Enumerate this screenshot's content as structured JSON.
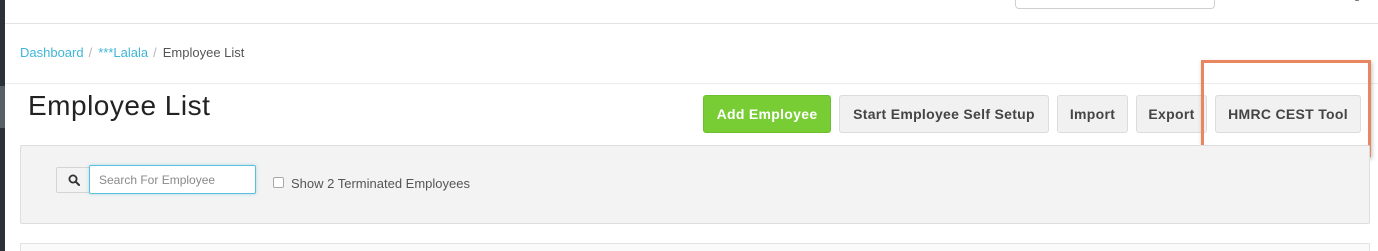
{
  "breadcrumb": {
    "items": [
      "Dashboard",
      "***Lalala"
    ],
    "separator": "/",
    "current": "Employee List"
  },
  "page": {
    "title": "Employee List"
  },
  "actions": {
    "add_employee": "Add Employee",
    "self_setup": "Start Employee Self Setup",
    "import": "Import",
    "export": "Export",
    "hmrc": "HMRC CEST Tool"
  },
  "filters": {
    "search_placeholder": "Search For Employee",
    "search_value": "",
    "search_icon": "search-icon",
    "show_terminated_label": "Show 2 Terminated Employees",
    "show_terminated_checked": false
  },
  "colors": {
    "link": "#3fb6d9",
    "success": "#78cd35",
    "highlight": "#e8875f",
    "rail": "#2b3137"
  }
}
